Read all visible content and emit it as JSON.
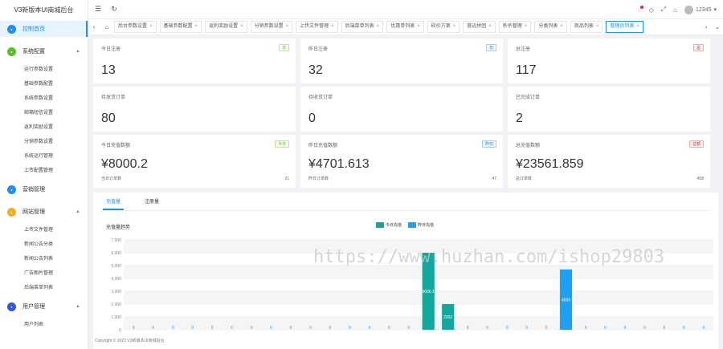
{
  "app": {
    "title": "V3新版本UI商城后台"
  },
  "sidebar": {
    "groups": [
      {
        "label": "控制首页",
        "color": "#1890ff",
        "icon": "home-icon",
        "active": true,
        "items": []
      },
      {
        "label": "系统配置",
        "color": "#52c41a",
        "icon": "gear-icon",
        "open": true,
        "items": [
          "运行参数设置",
          "基础参数配置",
          "系统参数设置",
          "邮箱短信设置",
          "返利奖励设置",
          "分销参数设置",
          "系统运行管理",
          "上传配置管理"
        ]
      },
      {
        "label": "营销管理",
        "color": "#1890ff",
        "icon": "target-icon",
        "items": []
      },
      {
        "label": "网站管理",
        "color": "#faad14",
        "icon": "star-icon",
        "open": true,
        "items": [
          "上传文件管理",
          "新闻公告分类",
          "新闻公告列表",
          "广告图片管理",
          "后端菜单列表"
        ]
      },
      {
        "label": "用户管理",
        "color": "#2f54eb",
        "icon": "user-icon",
        "open": true,
        "items": [
          "用户列表"
        ]
      }
    ]
  },
  "topbar": {
    "user": "12345"
  },
  "tabs": [
    "后台参数设置",
    "基础参数配置",
    "返利奖励设置",
    "分销参数设置",
    "上传文件管理",
    "后端菜单列表",
    "优惠劵列表",
    "砍价方案",
    "营运拼团",
    "秒杀管理",
    "分类列表",
    "商品列表",
    "管理员列表"
  ],
  "cards": [
    {
      "title": "今日注册",
      "tag": "日",
      "tagType": "green",
      "value": "13"
    },
    {
      "title": "昨日注册",
      "tag": "日",
      "tagType": "blue",
      "value": "32"
    },
    {
      "title": "总注册",
      "tag": "总",
      "tagType": "red",
      "value": "117"
    },
    {
      "title": "待发货订单",
      "value": "80"
    },
    {
      "title": "待收货订单",
      "value": "0"
    },
    {
      "title": "已完成订单",
      "value": "2"
    },
    {
      "title": "今日充值数额",
      "tag": "今日",
      "tagType": "green",
      "value": "¥8000.2",
      "foot": "当日订单数",
      "footVal": "21"
    },
    {
      "title": "昨日充值数额",
      "tag": "昨日",
      "tagType": "blue",
      "value": "¥4701.613",
      "foot": "昨日订单数",
      "footVal": "47"
    },
    {
      "title": "总充值数额",
      "tag": "总额",
      "tagType": "red",
      "value": "¥23561.859",
      "foot": "总订单数",
      "footVal": "458"
    }
  ],
  "panel": {
    "tabs": [
      "充值量",
      "注册量"
    ],
    "chart_title": "充值量趋势"
  },
  "chart_data": {
    "type": "bar",
    "title": "充值量趋势",
    "ylim": [
      0,
      7000
    ],
    "yticks": [
      0,
      1000,
      2000,
      3000,
      4000,
      5000,
      6000,
      7000
    ],
    "grid": true,
    "legend_position": "top",
    "series": [
      {
        "name": "今日充值",
        "color": "#13a89e",
        "values": [
          0,
          0,
          0,
          0,
          0,
          0,
          0,
          0,
          0,
          0,
          0,
          0,
          0,
          0,
          0,
          6000.1,
          2002,
          0,
          0,
          0,
          0,
          0,
          0,
          0,
          0,
          0,
          0,
          0,
          0,
          0
        ]
      },
      {
        "name": "昨日充值",
        "color": "#1e9ff2",
        "values": [
          0,
          0,
          0,
          0,
          0,
          0,
          0,
          0,
          0,
          0,
          0,
          0,
          0,
          0,
          0,
          0,
          0,
          0,
          0,
          0,
          0,
          0,
          4699,
          0,
          0,
          0,
          0,
          0,
          0,
          0
        ]
      }
    ]
  },
  "watermark": "https://www.huzhan.com/ishop29803",
  "copyright": "Copyright © 2023 V3新版本UI商城后台"
}
